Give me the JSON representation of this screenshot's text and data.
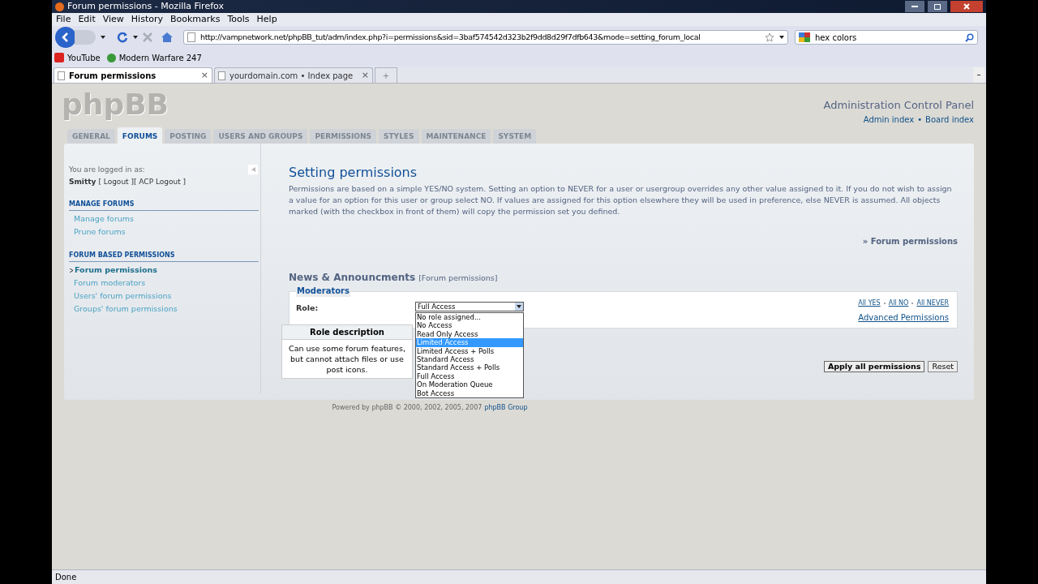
{
  "window": {
    "title": "Forum permissions - Mozilla Firefox"
  },
  "menu": [
    "File",
    "Edit",
    "View",
    "History",
    "Bookmarks",
    "Tools",
    "Help"
  ],
  "address": {
    "value": "http://vampnetwork.net/phpBB_tut/adm/index.php?i=permissions&sid=3baf574542d323b2f9dd8d29f7dfb643&mode=setting_forum_local"
  },
  "search": {
    "value": "hex colors"
  },
  "bookmarks": [
    "YouTube",
    "Modern Warfare 247"
  ],
  "tabs": [
    {
      "label": "Forum permissions",
      "selected": true,
      "close": "×"
    },
    {
      "label": "yourdomain.com • Index page",
      "selected": false,
      "close": "×"
    }
  ],
  "new_tab": "+",
  "header": {
    "logo": "phpBB",
    "title": "Administration Control Panel",
    "links": [
      "Admin index",
      "Board index"
    ],
    "separator": "•"
  },
  "nav_tabs": [
    {
      "label": "GENERAL",
      "selected": false
    },
    {
      "label": "FORUMS",
      "selected": true
    },
    {
      "label": "POSTING",
      "selected": false
    },
    {
      "label": "USERS AND GROUPS",
      "selected": false
    },
    {
      "label": "PERMISSIONS",
      "selected": false
    },
    {
      "label": "STYLES",
      "selected": false
    },
    {
      "label": "MAINTENANCE",
      "selected": false
    },
    {
      "label": "SYSTEM",
      "selected": false
    }
  ],
  "sidebar": {
    "logged_in": "You are logged in as:",
    "user": "Smitty",
    "logout": "[ Logout ]",
    "acp_logout": "[ ACP Logout ]",
    "sections": [
      {
        "title": "MANAGE FORUMS",
        "items": [
          {
            "label": "Manage forums",
            "selected": false
          },
          {
            "label": "Prune forums",
            "selected": false
          }
        ]
      },
      {
        "title": "FORUM BASED PERMISSIONS",
        "items": [
          {
            "label": "Forum permissions",
            "selected": true
          },
          {
            "label": "Forum moderators",
            "selected": false
          },
          {
            "label": "Users' forum permissions",
            "selected": false
          },
          {
            "label": "Groups' forum permissions",
            "selected": false
          }
        ]
      }
    ]
  },
  "main": {
    "title": "Setting permissions",
    "description": "Permissions are based on a simple YES/NO system. Setting an option to NEVER for a user or usergroup overrides any other value assigned to it. If you do not wish to assign a value for an option for this user or group select NO. If values are assigned for this option elsewhere they will be used in preference, else NEVER is assumed. All objects marked (with the checkbox in front of them) will copy the permission set you defined.",
    "breadcrumb": "» Forum permissions",
    "forum": "News & Announcments",
    "forum_note": "[Forum permissions]",
    "group": "Moderators",
    "role_label": "Role:",
    "role_value": "Full Access",
    "options": [
      {
        "label": "No role assigned...",
        "selected": false
      },
      {
        "label": "No Access",
        "selected": false
      },
      {
        "label": "Read Only Access",
        "selected": false
      },
      {
        "label": "Limited Access",
        "selected": true
      },
      {
        "label": "Limited Access + Polls",
        "selected": false
      },
      {
        "label": "Standard Access",
        "selected": false
      },
      {
        "label": "Standard Access + Polls",
        "selected": false
      },
      {
        "label": "Full Access",
        "selected": false
      },
      {
        "label": "On Moderation Queue",
        "selected": false
      },
      {
        "label": "Bot Access",
        "selected": false
      }
    ],
    "all_links": [
      "All YES",
      "All NO",
      "All NEVER"
    ],
    "advanced": "Advanced Permissions",
    "role_description": {
      "title": "Role description",
      "text": "Can use some forum features, but cannot attach files or use post icons."
    },
    "buttons": [
      "Apply all permissions",
      "Reset"
    ]
  },
  "footer": {
    "text": "Powered by phpBB © 2000, 2002, 2005, 2007",
    "link": "phpBB Group"
  },
  "status_bar": "Done"
}
